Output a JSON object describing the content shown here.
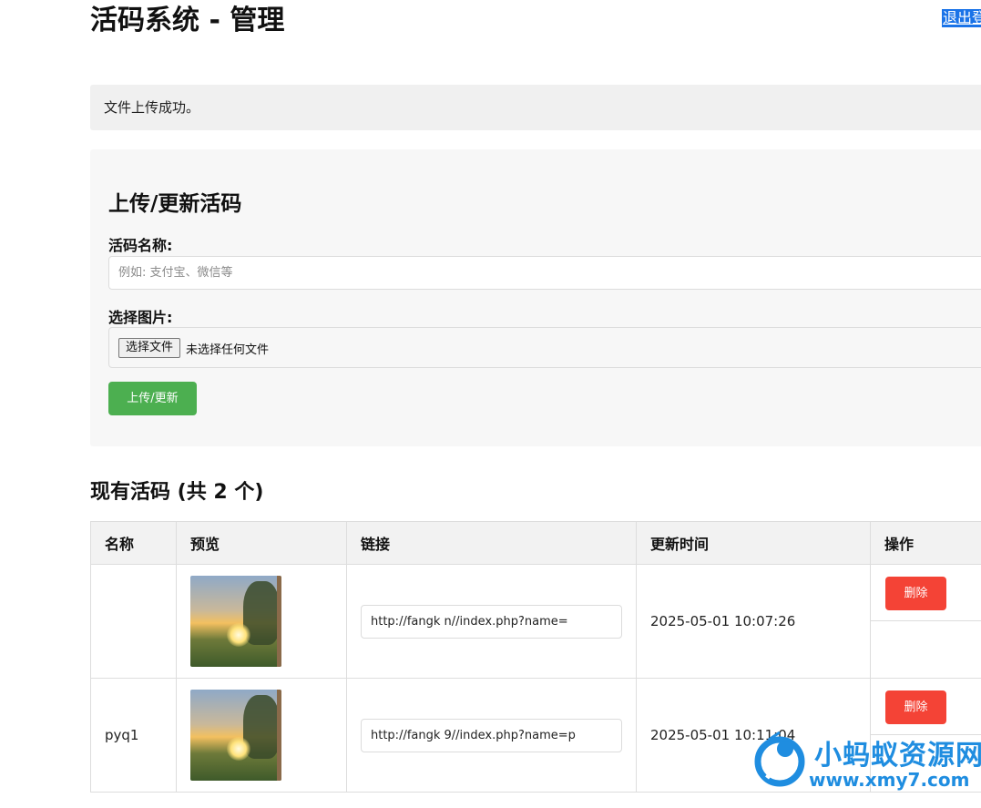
{
  "header": {
    "title": "活码系统 - 管理",
    "logout_label": "退出登录"
  },
  "alert": {
    "message": "文件上传成功。"
  },
  "upload_form": {
    "heading": "上传/更新活码",
    "name_label": "活码名称:",
    "name_placeholder": "例如: 支付宝、微信等",
    "image_label": "选择图片:",
    "file_button_label": "选择文件",
    "file_status": "未选择任何文件",
    "submit_label": "上传/更新"
  },
  "list": {
    "heading": "现有活码 (共 2 个)",
    "columns": [
      "名称",
      "预览",
      "链接",
      "更新时间",
      "操作"
    ],
    "rows": [
      {
        "name": "",
        "link": "http://fangk          n//index.php?name=",
        "updated": "2025-05-01 10:07:26",
        "delete_label": "删除"
      },
      {
        "name": "pyq1",
        "link": "http://fangk          9//index.php?name=p",
        "updated": "2025-05-01 10:11:04",
        "delete_label": "删除"
      }
    ]
  },
  "watermark": {
    "title": "小蚂蚁资源网",
    "url": "www.xmy7.com",
    "color": "#1f8de0"
  },
  "colors": {
    "submit": "#4caf50",
    "delete": "#f44336",
    "link": "#1a73e8"
  }
}
